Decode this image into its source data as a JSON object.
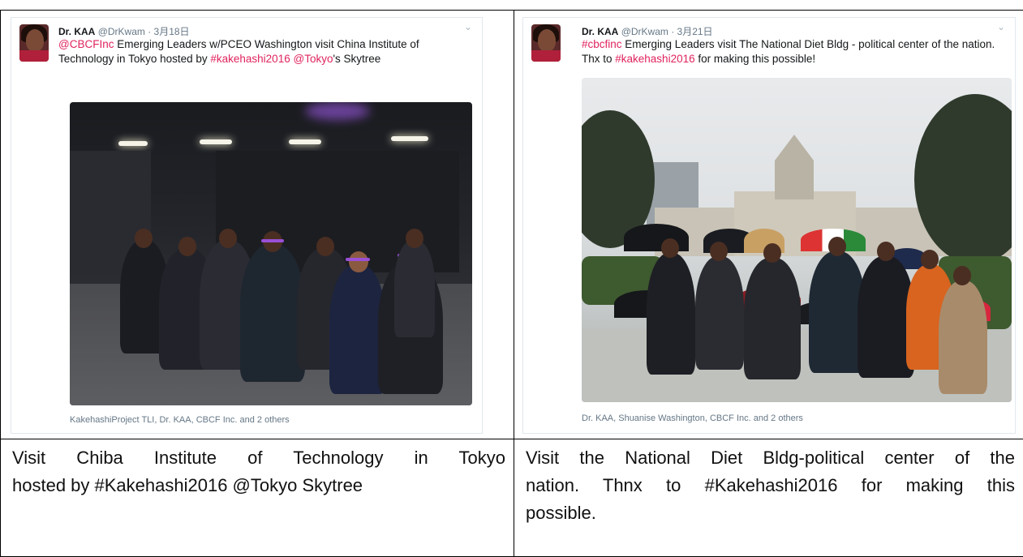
{
  "top_heading": "",
  "tweets": [
    {
      "author_name": "Dr. KAA",
      "author_meta": "@DrKwam · 3月18日",
      "text_parts": [
        {
          "t": "@CBCFInc",
          "hl": true
        },
        {
          "t": " Emerging Leaders w/PCEO Washington visit China Institute of Technology in Tokyo hosted by ",
          "hl": false
        },
        {
          "t": "#kakehashi2016",
          "hl": true
        },
        {
          "t": " ",
          "hl": false
        },
        {
          "t": "@Tokyo",
          "hl": true
        },
        {
          "t": "'s Skytree",
          "hl": false
        }
      ],
      "tagged": "KakehashiProject TLI, Dr. KAA, CBCF Inc. and 2 others",
      "chevron_icon": "chevron-down-icon"
    },
    {
      "author_name": "Dr. KAA",
      "author_meta": "@DrKwam · 3月21日",
      "text_parts": [
        {
          "t": "#cbcfinc",
          "hl": true
        },
        {
          "t": " Emerging Leaders visit The National Diet Bldg - political center of the nation. Thx to ",
          "hl": false
        },
        {
          "t": "#kakehashi2016",
          "hl": true
        },
        {
          "t": " for making this possible!",
          "hl": false
        }
      ],
      "tagged": "Dr. KAA, Shuanise Washington, CBCF Inc. and 2 others",
      "chevron_icon": "chevron-down-icon"
    }
  ],
  "captions": {
    "left_line1": "Visit Chiba Institute of Technology in Tokyo",
    "left_line2": "hosted by #Kakehashi2016 @Tokyo Skytree",
    "right_line1": "Visit the National Diet Bldg-political center of the",
    "right_line2": "nation. Thnx to #Kakehashi2016 for making this",
    "right_line3": "possible."
  },
  "colors": {
    "hashtag": "#e0245e",
    "meta": "#657786",
    "border": "#000000"
  }
}
